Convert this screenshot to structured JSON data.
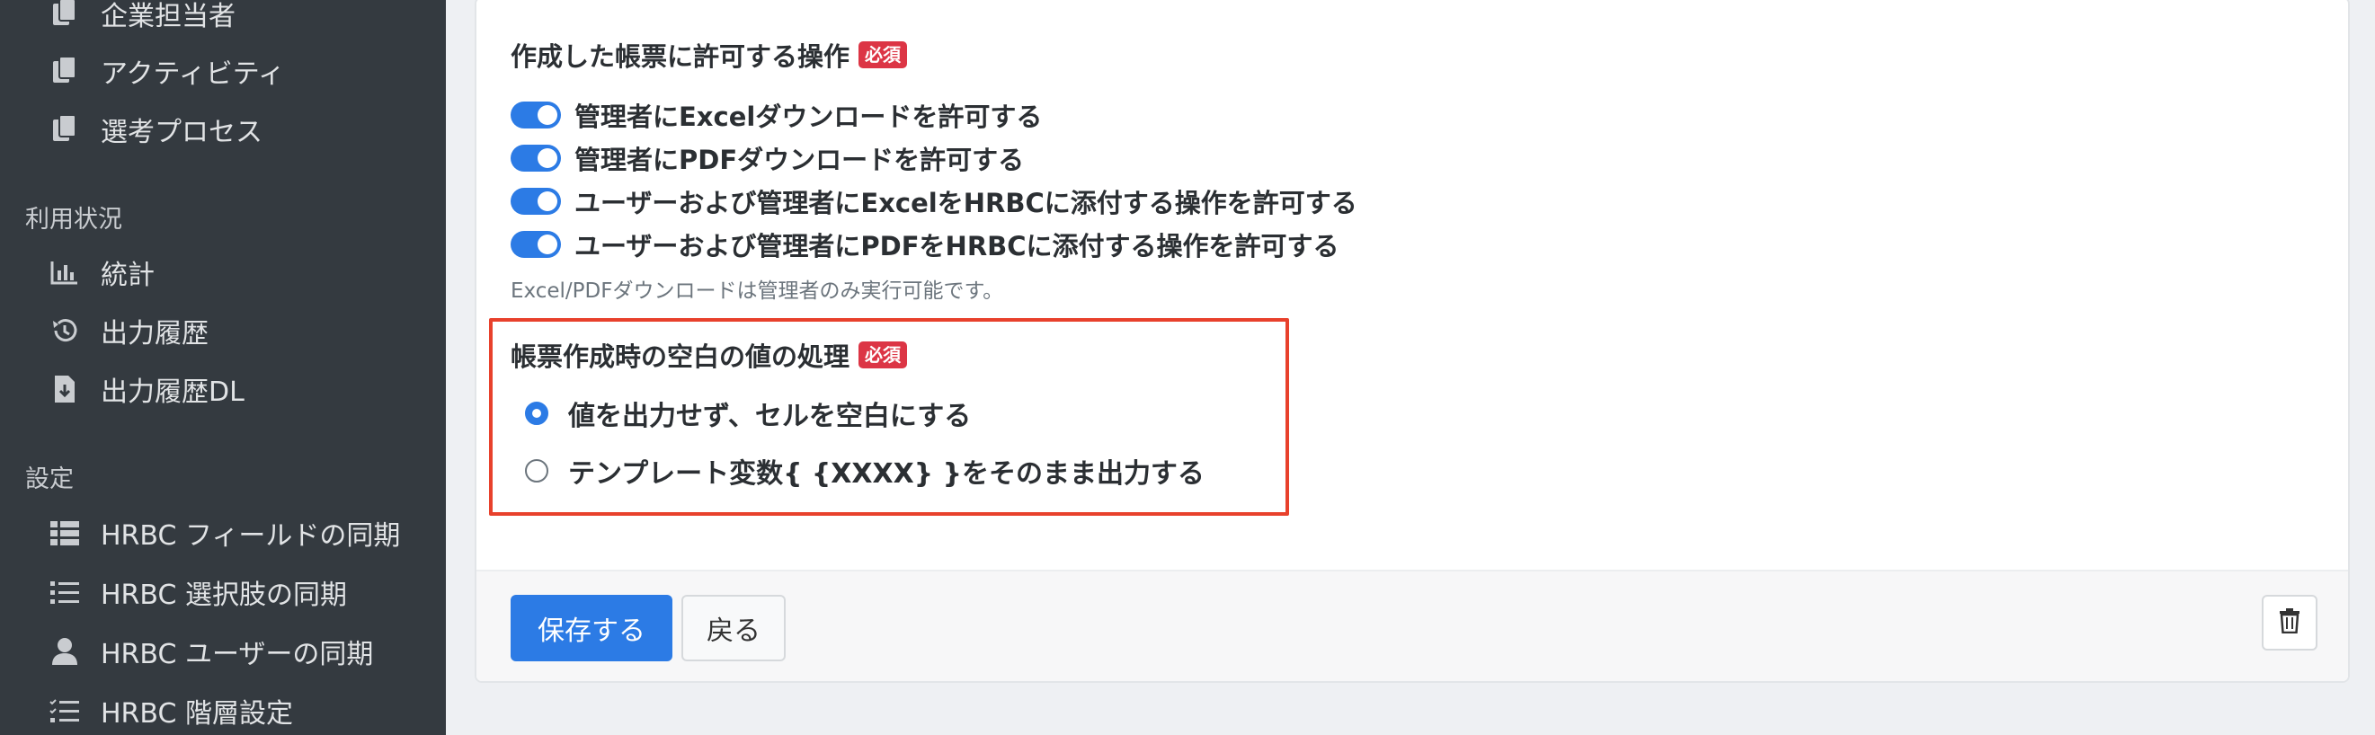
{
  "sidebar": {
    "top_items": [
      {
        "label": "企業担当者",
        "icon": "document-copy-icon"
      },
      {
        "label": "アクティビティ",
        "icon": "document-copy-icon"
      },
      {
        "label": "選考プロセス",
        "icon": "document-copy-icon"
      }
    ],
    "usage_heading": "利用状況",
    "usage_items": [
      {
        "label": "統計",
        "icon": "bar-chart-icon"
      },
      {
        "label": "出力履歴",
        "icon": "history-icon"
      },
      {
        "label": "出力履歴DL",
        "icon": "file-download-icon"
      }
    ],
    "settings_heading": "設定",
    "settings_items": [
      {
        "label": "HRBC フィールドの同期",
        "icon": "table-list-icon"
      },
      {
        "label": "HRBC 選択肢の同期",
        "icon": "list-icon"
      },
      {
        "label": "HRBC ユーザーの同期",
        "icon": "user-icon"
      },
      {
        "label": "HRBC 階層設定",
        "icon": "list-check-icon"
      }
    ]
  },
  "form": {
    "operations": {
      "label": "作成した帳票に許可する操作",
      "badge": "必須",
      "toggles": [
        {
          "label": "管理者にExcelダウンロードを許可する",
          "on": true
        },
        {
          "label": "管理者にPDFダウンロードを許可する",
          "on": true
        },
        {
          "label": "ユーザーおよび管理者にExcelをHRBCに添付する操作を許可する",
          "on": true
        },
        {
          "label": "ユーザーおよび管理者にPDFをHRBCに添付する操作を許可する",
          "on": true
        }
      ],
      "help": "Excel/PDFダウンロードは管理者のみ実行可能です。"
    },
    "blank": {
      "label": "帳票作成時の空白の値の処理",
      "badge": "必須",
      "options": [
        {
          "label": "値を出力せず、セルを空白にする",
          "selected": true
        },
        {
          "label": "テンプレート変数{ {XXXX} }をそのまま出力する",
          "selected": false
        }
      ]
    }
  },
  "footer": {
    "save_label": "保存する",
    "back_label": "戻る",
    "delete_icon": "trash-icon"
  },
  "colors": {
    "sidebar_bg": "#343a40",
    "primary": "#2c7be5",
    "required_badge": "#dc3545",
    "highlight_border": "#e8412c"
  }
}
